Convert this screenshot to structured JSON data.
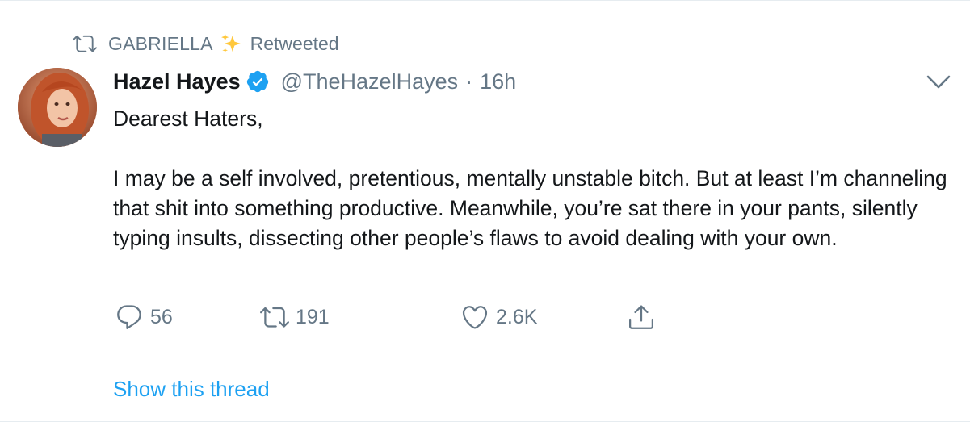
{
  "retweet": {
    "user": "GABRIELLA",
    "emoji": "sparkles-icon",
    "label": "Retweeted"
  },
  "author": {
    "display_name": "Hazel Hayes",
    "verified": true,
    "handle": "@TheHazelHayes",
    "separator": "·",
    "time": "16h"
  },
  "text": "Dearest Haters,\n\nI may be a self involved, pretentious, mentally unstable bitch. But at least I’m channeling that shit into something productive. Meanwhile, you’re sat there in your pants, silently typing insults, dissecting other people’s flaws to avoid dealing with your own.",
  "actions": {
    "replies": "56",
    "retweets": "191",
    "likes": "2.6K"
  },
  "thread_link": "Show this thread",
  "colors": {
    "accent": "#1da1f2",
    "muted": "#657786",
    "text": "#14171a",
    "retweet_icon": "#657786",
    "verified_badge": "#1da1f2",
    "sparkle": "#ffc83d"
  }
}
